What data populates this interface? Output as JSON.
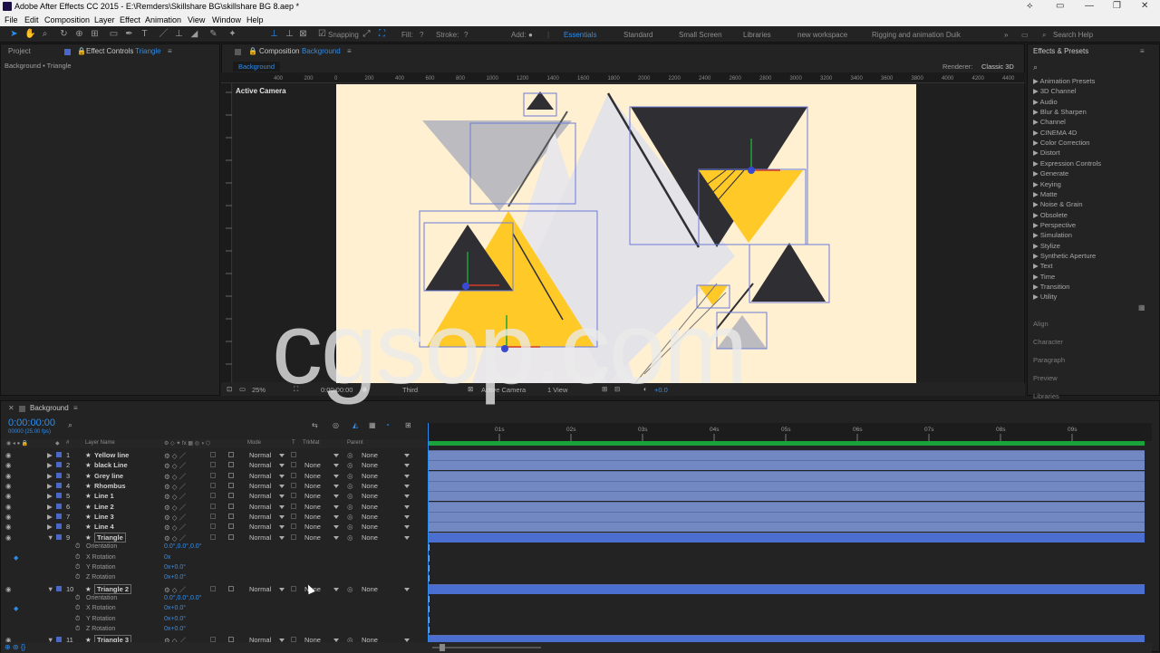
{
  "window": {
    "title": "Adobe After Effects CC 2015 - E:\\Remders\\Skillshare BG\\skillshare BG 8.aep *"
  },
  "menu": [
    "File",
    "Edit",
    "Composition",
    "Layer",
    "Effect",
    "Animation",
    "View",
    "Window",
    "Help"
  ],
  "toolbar": {
    "snapping": "Snapping",
    "fill": "Fill:",
    "stroke": "Stroke:",
    "add": "Add:",
    "q": "?",
    "workspaces": [
      "Essentials",
      "Standard",
      "Small Screen",
      "Libraries",
      "new workspace",
      "Rigging and animation Duik"
    ],
    "active_workspace": "Essentials",
    "search_help": "Search Help"
  },
  "left_panel": {
    "tab_project": "Project",
    "tab_effect_controls": "Effect Controls",
    "effect_layer": "Triangle",
    "breadcrumb": "Background • Triangle"
  },
  "comp_panel": {
    "tab": "Composition",
    "comp_name": "Background",
    "subtab": "Background",
    "renderer_label": "Renderer:",
    "renderer": "Classic 3D",
    "camera": "Active Camera",
    "ruler": [
      "400",
      "200",
      "0",
      "200",
      "400",
      "600",
      "800",
      "1000",
      "1200",
      "1400",
      "1600",
      "1800",
      "2000",
      "2200",
      "2400",
      "2600",
      "2800",
      "3000",
      "3200",
      "3400",
      "3600",
      "3800",
      "4000",
      "4200",
      "4400"
    ],
    "footer": {
      "zoom": "25%",
      "time": "0:00:00:00",
      "res": "Third",
      "view": "Active Camera",
      "views": "1 View",
      "exposure": "+0.0"
    }
  },
  "effects_presets": {
    "title": "Effects & Presets",
    "items": [
      "Animation Presets",
      "3D Channel",
      "Audio",
      "Blur & Sharpen",
      "Channel",
      "CINEMA 4D",
      "Color Correction",
      "Distort",
      "Expression Controls",
      "Generate",
      "Keying",
      "Matte",
      "Noise & Grain",
      "Obsolete",
      "Perspective",
      "Simulation",
      "Stylize",
      "Synthetic Aperture",
      "Text",
      "Time",
      "Transition",
      "Utility"
    ],
    "collapsed": [
      "Align",
      "Character",
      "Paragraph",
      "Preview",
      "Libraries"
    ]
  },
  "timeline": {
    "comp": "Background",
    "timecode": "0:00:00:00",
    "fps": "00000 (25.00 fps)",
    "headers": {
      "num": "#",
      "layer_name": "Layer Name",
      "mode": "Mode",
      "t": "T",
      "trkmat": "TrkMat",
      "parent": "Parent"
    },
    "ticks": [
      "01s",
      "02s",
      "03s",
      "04s",
      "05s",
      "06s",
      "07s",
      "08s",
      "09s"
    ],
    "layers": [
      {
        "num": "1",
        "name": "Yellow line",
        "mode": "Normal",
        "trkmat": "",
        "parent": "None"
      },
      {
        "num": "2",
        "name": "black Line",
        "mode": "Normal",
        "trkmat": "None",
        "parent": "None"
      },
      {
        "num": "3",
        "name": "Grey line",
        "mode": "Normal",
        "trkmat": "None",
        "parent": "None"
      },
      {
        "num": "4",
        "name": "Rhombus",
        "mode": "Normal",
        "trkmat": "None",
        "parent": "None"
      },
      {
        "num": "5",
        "name": "Line 1",
        "mode": "Normal",
        "trkmat": "None",
        "parent": "None"
      },
      {
        "num": "6",
        "name": "Line 2",
        "mode": "Normal",
        "trkmat": "None",
        "parent": "None"
      },
      {
        "num": "7",
        "name": "Line 3",
        "mode": "Normal",
        "trkmat": "None",
        "parent": "None"
      },
      {
        "num": "8",
        "name": "Line 4",
        "mode": "Normal",
        "trkmat": "None",
        "parent": "None"
      },
      {
        "num": "9",
        "name": "Triangle",
        "mode": "Normal",
        "trkmat": "None",
        "parent": "None"
      }
    ],
    "layer9_props": [
      {
        "name": "Orientation",
        "value": "0.0°,0.0°,0.0°"
      },
      {
        "name": "X Rotation",
        "value": "0x"
      },
      {
        "name": "Y Rotation",
        "value": "0x+0.0°"
      },
      {
        "name": "Z Rotation",
        "value": "0x+0.0°"
      }
    ],
    "layer10": {
      "num": "10",
      "name": "Triangle 2",
      "mode": "Normal",
      "trkmat": "None",
      "parent": "None"
    },
    "layer10_props": [
      {
        "name": "Orientation",
        "value": "0.0°,0.0°,0.0°"
      },
      {
        "name": "X Rotation",
        "value": "0x+0.0°"
      },
      {
        "name": "Y Rotation",
        "value": "0x+0.0°"
      },
      {
        "name": "Z Rotation",
        "value": "0x+0.0°"
      }
    ],
    "layer11": {
      "num": "11",
      "name": "Triangle 3",
      "mode": "Normal",
      "trkmat": "None",
      "parent": "None"
    }
  },
  "watermark": "cgsop.com",
  "colors": {
    "accent": "#2d8ceb",
    "canvas": "#fff0d2",
    "yellow": "#ffc928",
    "dark": "#2f2f33",
    "grey": "#bcbcc0",
    "bar": "#7288c2"
  }
}
